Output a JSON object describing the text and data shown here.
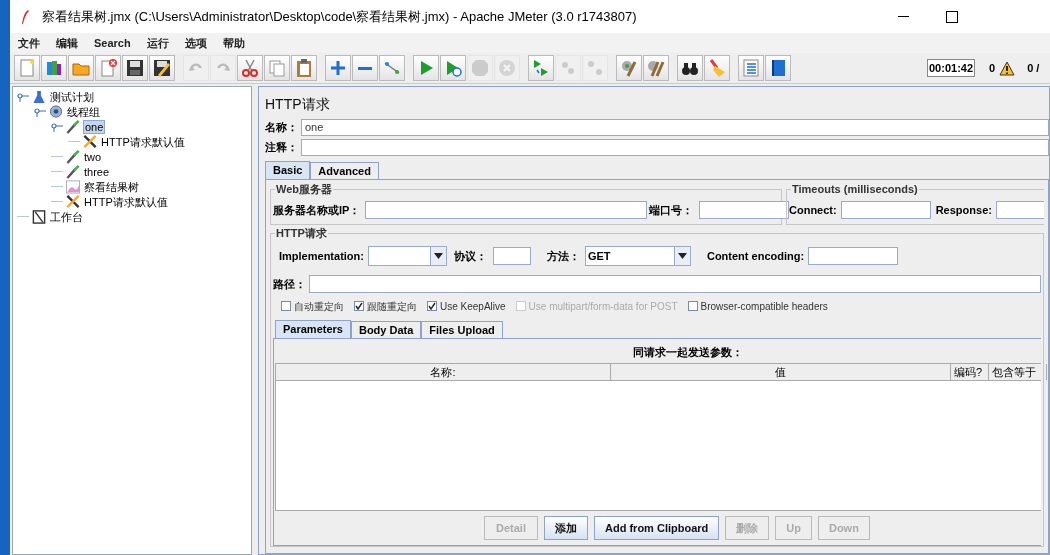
{
  "window": {
    "title": "察看结果树.jmx (C:\\Users\\Administrator\\Desktop\\code\\察看结果树.jmx) - Apache JMeter (3.0 r1743807)"
  },
  "menu": [
    "文件",
    "编辑",
    "Search",
    "运行",
    "选项",
    "帮助"
  ],
  "toolbar_groups": [
    [
      {
        "kind": "new",
        "disabled": false
      },
      {
        "kind": "templates",
        "disabled": false
      },
      {
        "kind": "open",
        "disabled": false
      },
      {
        "kind": "close",
        "disabled": false
      },
      {
        "kind": "save",
        "disabled": false
      },
      {
        "kind": "save-as",
        "disabled": false
      }
    ],
    [
      {
        "kind": "undo",
        "disabled": true
      },
      {
        "kind": "redo",
        "disabled": true
      },
      {
        "kind": "cut",
        "disabled": false
      },
      {
        "kind": "copy",
        "disabled": false
      },
      {
        "kind": "paste",
        "disabled": false
      }
    ],
    [
      {
        "kind": "expand",
        "disabled": false
      },
      {
        "kind": "collapse",
        "disabled": false
      },
      {
        "kind": "toggle",
        "disabled": false
      }
    ],
    [
      {
        "kind": "start",
        "disabled": false
      },
      {
        "kind": "start-no-pause",
        "disabled": false
      },
      {
        "kind": "stop",
        "disabled": true
      },
      {
        "kind": "shutdown",
        "disabled": true
      }
    ],
    [
      {
        "kind": "remote-start",
        "disabled": false
      },
      {
        "kind": "remote-stop",
        "disabled": true
      },
      {
        "kind": "remote-exit",
        "disabled": true
      }
    ],
    [
      {
        "kind": "clear",
        "disabled": false
      },
      {
        "kind": "clear-all",
        "disabled": false
      }
    ],
    [
      {
        "kind": "search",
        "disabled": false
      },
      {
        "kind": "reset",
        "disabled": false
      }
    ],
    [
      {
        "kind": "function",
        "disabled": false
      },
      {
        "kind": "help",
        "disabled": false
      }
    ]
  ],
  "status": {
    "timer": "00:01:42",
    "errors": "0",
    "threads": "0 /"
  },
  "tree": [
    {
      "label": "测试计划",
      "kind": "plan",
      "selected": false,
      "children": [
        {
          "label": "线程组",
          "kind": "thread-group",
          "selected": false,
          "children": [
            {
              "label": "one",
              "kind": "sampler",
              "selected": true,
              "children": [
                {
                  "label": "HTTP请求默认值",
                  "kind": "config",
                  "selected": false
                }
              ]
            },
            {
              "label": "two",
              "kind": "sampler",
              "selected": false
            },
            {
              "label": "three",
              "kind": "sampler",
              "selected": false
            },
            {
              "label": "察看结果树",
              "kind": "listener",
              "selected": false
            },
            {
              "label": "HTTP请求默认值",
              "kind": "config",
              "selected": false
            }
          ]
        }
      ]
    },
    {
      "label": "工作台",
      "kind": "workbench",
      "selected": false
    }
  ],
  "panel": {
    "title": "HTTP请求",
    "name_label": "名称：",
    "name_value": "one",
    "comment_label": "注释：",
    "tabs": [
      {
        "label": "Basic",
        "selected": true
      },
      {
        "label": "Advanced",
        "selected": false
      }
    ],
    "web_server": {
      "legend": "Web服务器",
      "server_label": "服务器名称或IP：",
      "port_label": "端口号："
    },
    "timeouts": {
      "legend": "Timeouts (milliseconds)",
      "connect_label": "Connect:",
      "response_label": "Response:"
    },
    "http_request": {
      "legend": "HTTP请求",
      "implementation_label": "Implementation:",
      "protocol_label": "协议：",
      "method_label": "方法：",
      "method_value": "GET",
      "encoding_label": "Content encoding:",
      "path_label": "路径："
    },
    "checkboxes": [
      {
        "label": "自动重定向",
        "checked": false,
        "disabled": false
      },
      {
        "label": "跟随重定向",
        "checked": true,
        "disabled": false
      },
      {
        "label": "Use KeepAlive",
        "checked": true,
        "disabled": false
      },
      {
        "label": "Use multipart/form-data for POST",
        "checked": false,
        "disabled": true
      },
      {
        "label": "Browser-compatible headers",
        "checked": false,
        "disabled": false
      }
    ],
    "param_tabs": [
      {
        "label": "Parameters",
        "selected": true
      },
      {
        "label": "Body Data",
        "selected": false
      },
      {
        "label": "Files Upload",
        "selected": false
      }
    ],
    "table": {
      "caption": "同请求一起发送参数：",
      "columns": [
        "名称:",
        "值",
        "编码?",
        "包含等于"
      ]
    },
    "buttons": [
      {
        "label": "Detail",
        "disabled": true
      },
      {
        "label": "添加",
        "disabled": false
      },
      {
        "label": "Add from Clipboard",
        "disabled": false
      },
      {
        "label": "删除",
        "disabled": true
      },
      {
        "label": "Up",
        "disabled": true
      },
      {
        "label": "Down",
        "disabled": true
      }
    ]
  }
}
